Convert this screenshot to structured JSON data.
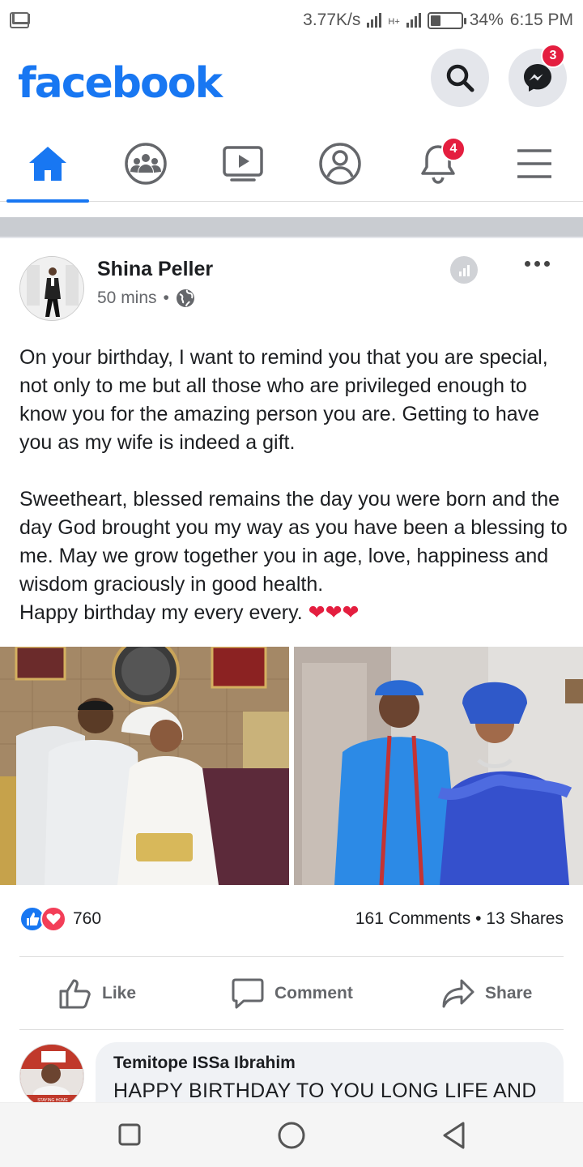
{
  "status_bar": {
    "speed": "3.77K/s",
    "network": "H+",
    "battery": "34%",
    "time": "6:15 PM"
  },
  "header": {
    "logo": "facebook",
    "messenger_badge": "3"
  },
  "tabs": [
    {
      "name": "home",
      "active": true
    },
    {
      "name": "groups"
    },
    {
      "name": "watch"
    },
    {
      "name": "profile"
    },
    {
      "name": "notifications",
      "badge": "4"
    },
    {
      "name": "menu"
    }
  ],
  "post": {
    "author": "Shina Peller",
    "time": "50 mins",
    "separator": "•",
    "text": "On your birthday, I want to remind you that you are special, not only to me but all those who are privileged enough to know you for the amazing person you are. Getting to have you as my wife is indeed a gift.\n\nSweetheart, blessed remains the day you were born and the day God brought you my way as you have been a blessing to me. May we grow together you in age, love, happiness and wisdom graciously in good health.\nHappy birthday my every every. ❤❤❤",
    "reaction_count": "760",
    "comments_shares": "161 Comments • 13 Shares"
  },
  "actions": {
    "like": "Like",
    "comment": "Comment",
    "share": "Share"
  },
  "comment": {
    "author": "Temitope ISSa Ibrahim",
    "text": "HAPPY BIRTHDAY TO YOU LONG LIFE AND",
    "avatar_caption": "STAYING HOME SAVING LIVES"
  },
  "colors": {
    "brand": "#1877f2",
    "badge": "#e41e3f",
    "love": "#f33e58"
  }
}
